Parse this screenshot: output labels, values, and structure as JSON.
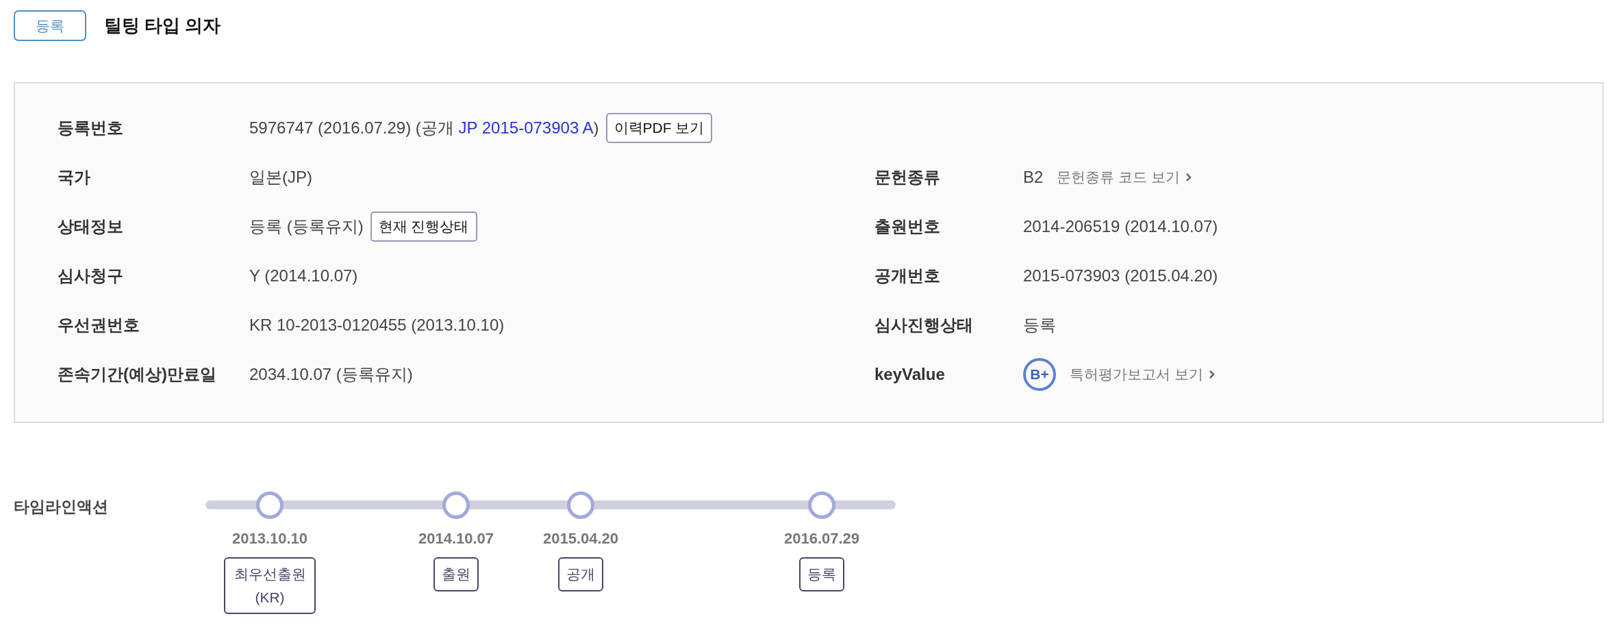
{
  "status_badge": "등록",
  "title": "틸팅 타입 의자",
  "rows": [
    {
      "cells": [
        {
          "label": "등록번호",
          "kind": "publication",
          "value": "5976747 (2016.07.29) (공개",
          "link": "JP 2015-073903 A",
          "suffix": ")",
          "button": "이력PDF 보기"
        }
      ]
    },
    {
      "cells": [
        {
          "label": "국가",
          "kind": "text",
          "value": "일본(JP)"
        },
        {
          "label": "문헌종류",
          "kind": "more",
          "value": "B2",
          "more": "문헌종류 코드 보기"
        }
      ]
    },
    {
      "cells": [
        {
          "label": "상태정보",
          "kind": "button",
          "value": "등록 (등록유지)",
          "button": "현재 진행상태"
        },
        {
          "label": "출원번호",
          "kind": "text",
          "value": "2014-206519 (2014.10.07)"
        }
      ]
    },
    {
      "cells": [
        {
          "label": "심사청구",
          "kind": "text",
          "value": "Y (2014.10.07)"
        },
        {
          "label": "공개번호",
          "kind": "text",
          "value": "2015-073903 (2015.04.20)"
        }
      ]
    },
    {
      "cells": [
        {
          "label": "우선권번호",
          "kind": "text",
          "value": "KR 10-2013-0120455 (2013.10.10)"
        },
        {
          "label": "심사진행상태",
          "kind": "text",
          "value": "등록"
        }
      ]
    },
    {
      "cells": [
        {
          "label": "존속기간(예상)만료일",
          "kind": "text",
          "value": "2034.10.07 (등록유지)"
        },
        {
          "label": "keyValue",
          "kind": "grade",
          "grade": "B+",
          "more": "특허평가보고서 보기"
        }
      ]
    }
  ],
  "timeline": {
    "label": "타임라인액션",
    "events": [
      {
        "date": "2013.10.10",
        "tag": "최우선출원 (KR)"
      },
      {
        "date": "2014.10.07",
        "tag": "출원"
      },
      {
        "date": "2015.04.20",
        "tag": "공개"
      },
      {
        "date": "2016.07.29",
        "tag": "등록"
      }
    ]
  }
}
